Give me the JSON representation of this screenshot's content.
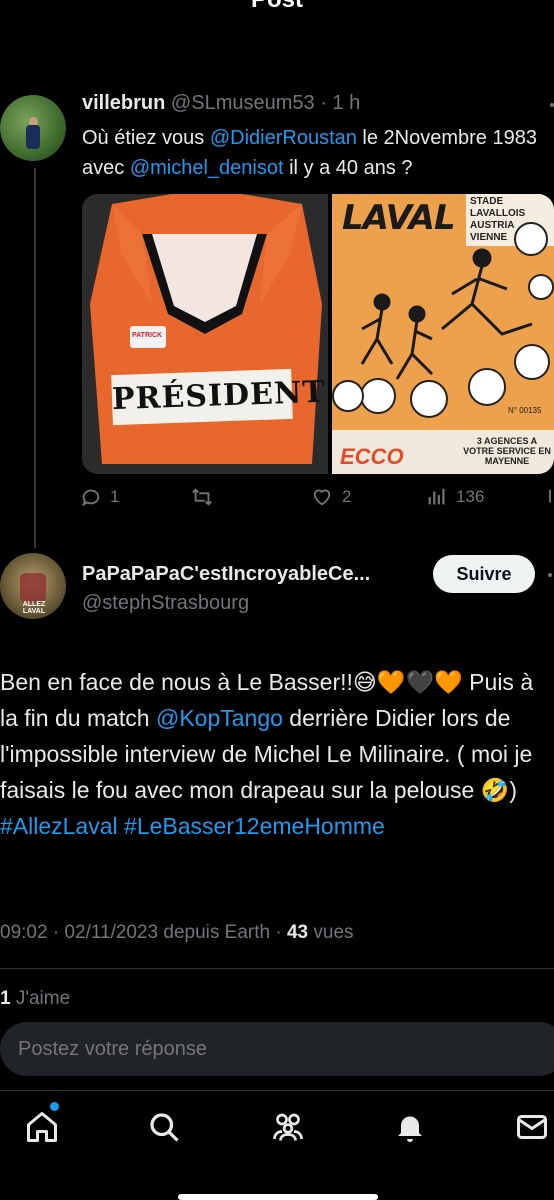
{
  "header": {
    "title": "Post"
  },
  "original_tweet": {
    "name": "villebrun",
    "handle": "@SLmuseum53",
    "sep": "·",
    "time": "1 h",
    "text_1": "Où étiez vous ",
    "mention_1": "@DidierRoustan",
    "text_2": " le 2Novembre 1983 avec ",
    "mention_2": "@michel_denisot",
    "text_3": "  il y a 40 ans ?",
    "media": {
      "jersey_brand": "PATRICK",
      "jersey_text": "PRÉSIDENT",
      "poster_title": "LAVAL",
      "poster_box": "STADE LAVALLOIS AUSTRIA VIENNE",
      "poster_footer_left": "ECCO",
      "poster_footer_right": "3 AGENCES A VOTRE SERVICE EN MAYENNE",
      "poster_number": "N° 00135"
    },
    "stats": {
      "replies": "1",
      "retweets": "",
      "likes": "2",
      "views": "136"
    }
  },
  "reply": {
    "name": "PaPaPaPaC'estIncroyableCe...",
    "handle": "@stephStrasbourg",
    "follow_label": "Suivre",
    "avatar_caption": "ALLEZ LAVAL",
    "text_a": "Ben en face de nous à Le Basser!!",
    "emojis_a": "😅🧡🖤🧡",
    "text_b": " Puis à la fin du match ",
    "mention": "@KopTango",
    "text_c": " derrière Didier lors de l'impossible interview de Michel Le Milinaire. ( moi je faisais le fou avec mon drapeau sur la pelouse ",
    "emoji_b": "🤣",
    "text_d": ") ",
    "hashtag_1": "#AllezLaval",
    "hashtag_2": "#LeBasser12emeHomme",
    "meta_time": "09:02 · 02/11/2023 depuis Earth · ",
    "meta_views_count": "43",
    "meta_views_label": " vues",
    "likes_count": "1",
    "likes_label": " J'aime"
  },
  "composer": {
    "placeholder": "Postez votre réponse"
  },
  "colors": {
    "accent": "#1d9bf0",
    "background": "#000000",
    "muted": "#71767b",
    "text": "#e7e9ea"
  }
}
